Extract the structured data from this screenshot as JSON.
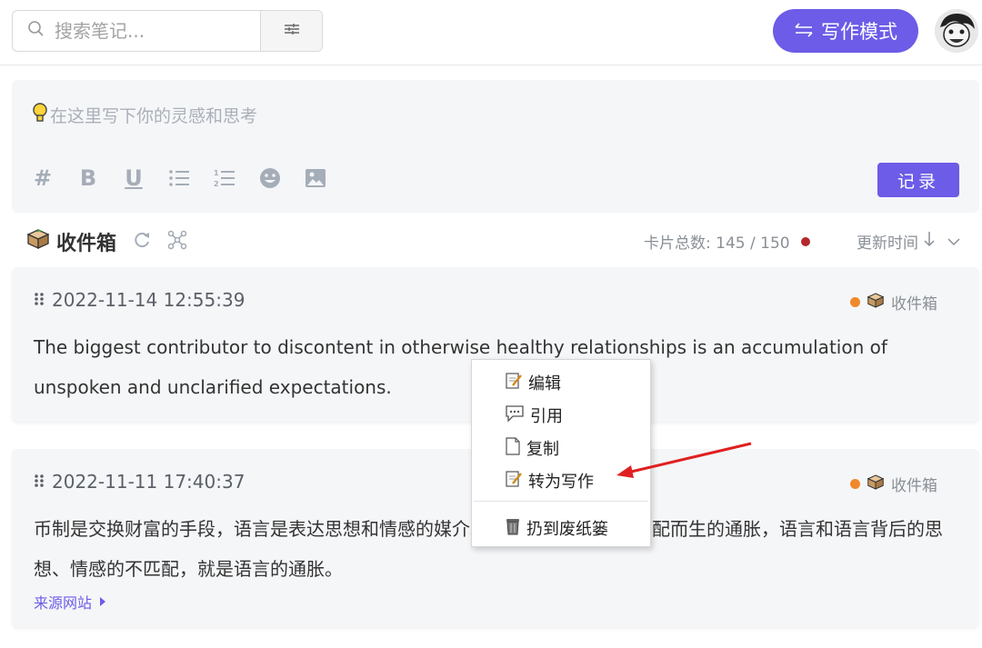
{
  "search": {
    "placeholder": "搜索笔记..."
  },
  "header": {
    "write_mode_label": "写作模式"
  },
  "editor": {
    "placeholder": "在这里写下你的灵感和思考",
    "record_label": "记录",
    "tools": [
      "#",
      "B",
      "U"
    ]
  },
  "inbox": {
    "title": "收件箱",
    "count_label": "卡片总数:",
    "count_value": "145 / 150",
    "sort_label": "更新时间"
  },
  "cards": [
    {
      "time": "2022-11-14 12:55:39",
      "tag": "收件箱",
      "text": "The biggest contributor to discontent in otherwise healthy relationships is an accumulation of unspoken and unclarified expectations."
    },
    {
      "time": "2022-11-11 17:40:37",
      "tag": "收件箱",
      "text": "币制是交换财富的手段，语言是表达思想和情感的媒介。货币背后财富的不匹配而生的通胀，语言和语言背后的思想、情感的不匹配，就是语言的通胀。",
      "source_label": "来源网站"
    }
  ],
  "context_menu": {
    "items": [
      "编辑",
      "引用",
      "复制",
      "转为写作",
      "扔到废纸篓"
    ]
  },
  "colors": {
    "accent": "#6c5ce7",
    "status_red": "#b3282d",
    "tag_orange": "#f0892b",
    "arrow_red": "#e02020"
  },
  "icons": [
    "search-icon",
    "filter-icon",
    "swap-icon",
    "lightbulb-icon",
    "hashtag-icon",
    "bold-icon",
    "underline-icon",
    "bullet-list-icon",
    "numbered-list-icon",
    "emoji-icon",
    "image-icon",
    "box-icon",
    "refresh-icon",
    "network-icon",
    "arrow-down-icon",
    "chevron-down-icon",
    "grip-icon",
    "edit-icon",
    "quote-icon",
    "copy-icon",
    "trash-icon"
  ]
}
